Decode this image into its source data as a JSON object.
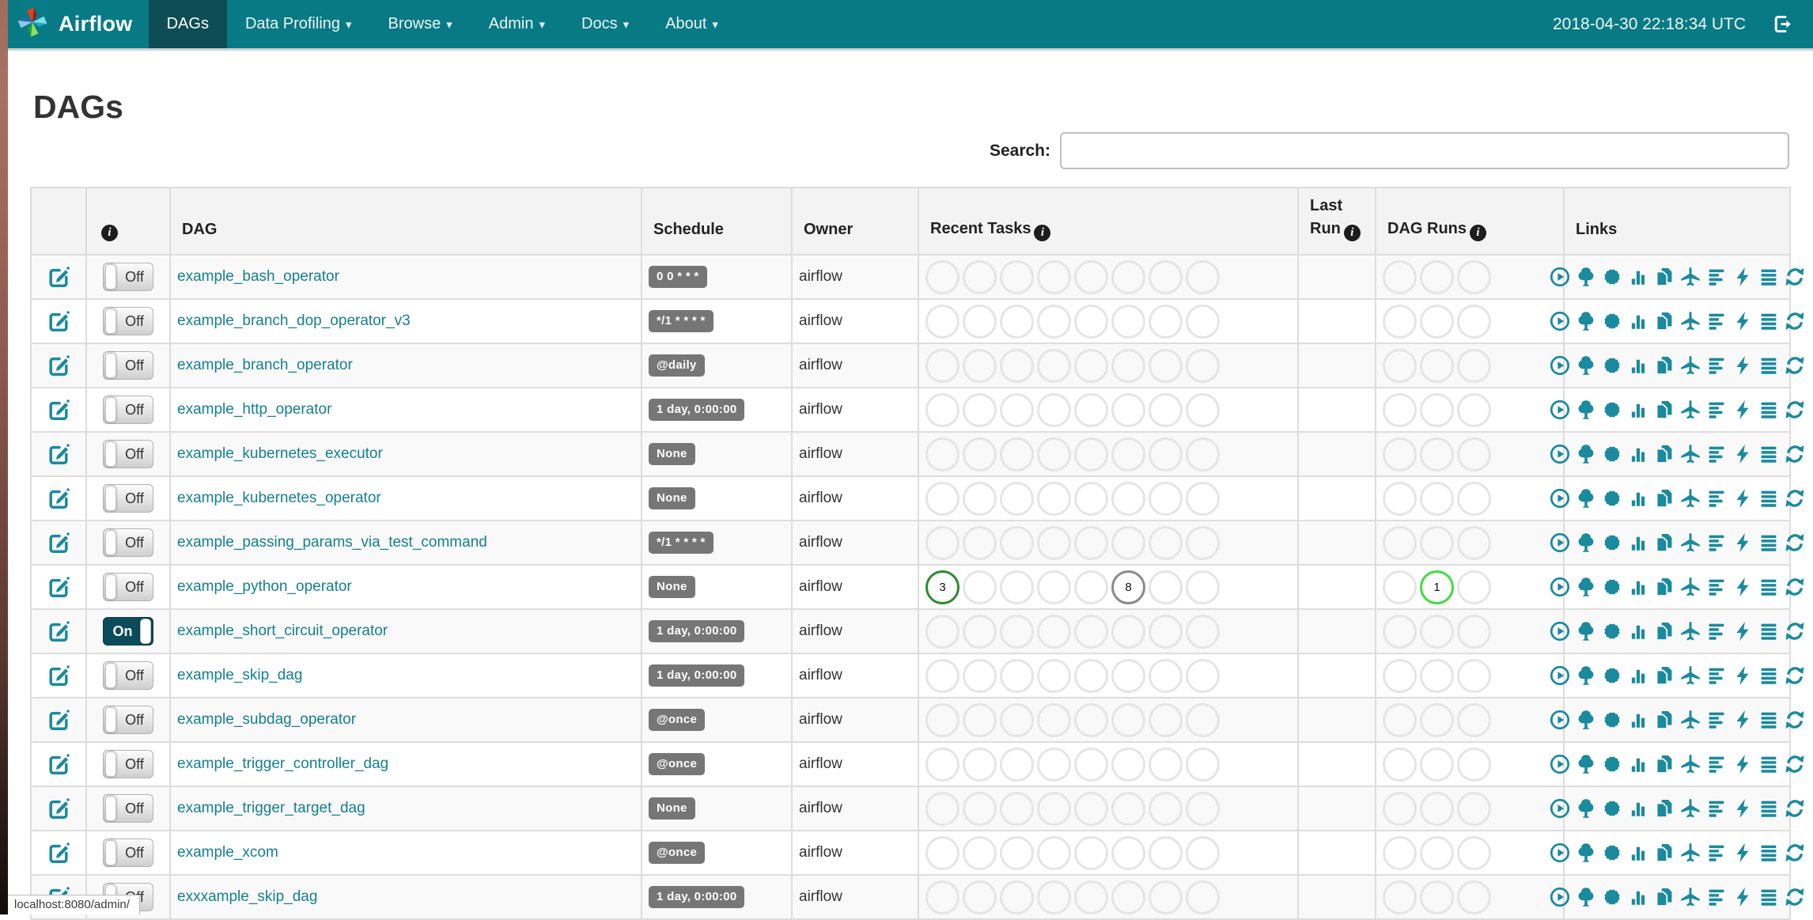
{
  "navbar": {
    "brand": "Airflow",
    "items": [
      {
        "label": "DAGs",
        "active": true,
        "caret": false
      },
      {
        "label": "Data Profiling",
        "active": false,
        "caret": true
      },
      {
        "label": "Browse",
        "active": false,
        "caret": true
      },
      {
        "label": "Admin",
        "active": false,
        "caret": true
      },
      {
        "label": "Docs",
        "active": false,
        "caret": true
      },
      {
        "label": "About",
        "active": false,
        "caret": true
      }
    ],
    "clock": "2018-04-30 22:18:34 UTC",
    "icons": {
      "logo": "airflow-pinwheel-logo",
      "logout": "sign-out-icon"
    }
  },
  "page": {
    "title": "DAGs",
    "search_label": "Search:",
    "search_value": "",
    "status_bar": "localhost:8080/admin/"
  },
  "table": {
    "headers": {
      "info_col": "",
      "dag": "DAG",
      "schedule": "Schedule",
      "owner": "Owner",
      "recent_tasks": "Recent Tasks",
      "last_run_line1": "Last",
      "last_run_line2": "Run",
      "dag_runs": "DAG Runs",
      "links": "Links"
    },
    "toggle_labels": {
      "on": "On",
      "off": "Off"
    },
    "recent_tasks_slots": 8,
    "dag_runs_slots": 3,
    "links_icons": [
      "trigger-dag-icon",
      "tree-view-icon",
      "graph-view-icon",
      "task-duration-icon",
      "task-tries-icon",
      "landing-times-icon",
      "gantt-view-icon",
      "code-view-icon",
      "logs-icon",
      "refresh-icon"
    ],
    "dags": [
      {
        "name": "example_bash_operator",
        "enabled": false,
        "schedule": "0 0 * * *",
        "owner": "airflow",
        "recent_tasks": [],
        "dag_runs": []
      },
      {
        "name": "example_branch_dop_operator_v3",
        "enabled": false,
        "schedule": "*/1 * * * *",
        "owner": "airflow",
        "recent_tasks": [],
        "dag_runs": []
      },
      {
        "name": "example_branch_operator",
        "enabled": false,
        "schedule": "@daily",
        "owner": "airflow",
        "recent_tasks": [],
        "dag_runs": []
      },
      {
        "name": "example_http_operator",
        "enabled": false,
        "schedule": "1 day, 0:00:00",
        "owner": "airflow",
        "recent_tasks": [],
        "dag_runs": []
      },
      {
        "name": "example_kubernetes_executor",
        "enabled": false,
        "schedule": "None",
        "owner": "airflow",
        "recent_tasks": [],
        "dag_runs": []
      },
      {
        "name": "example_kubernetes_operator",
        "enabled": false,
        "schedule": "None",
        "owner": "airflow",
        "recent_tasks": [],
        "dag_runs": []
      },
      {
        "name": "example_passing_params_via_test_command",
        "enabled": false,
        "schedule": "*/1 * * * *",
        "owner": "airflow",
        "recent_tasks": [],
        "dag_runs": []
      },
      {
        "name": "example_python_operator",
        "enabled": false,
        "schedule": "None",
        "owner": "airflow",
        "recent_tasks": [
          {
            "slot": 0,
            "count": "3",
            "state": "success",
            "color": "#2e8b2e"
          },
          {
            "slot": 5,
            "count": "8",
            "state": "queued",
            "color": "#8a8a8a"
          }
        ],
        "dag_runs": [
          {
            "slot": 1,
            "count": "1",
            "state": "running",
            "color": "#3fdd3f"
          }
        ]
      },
      {
        "name": "example_short_circuit_operator",
        "enabled": true,
        "schedule": "1 day, 0:00:00",
        "owner": "airflow",
        "recent_tasks": [],
        "dag_runs": []
      },
      {
        "name": "example_skip_dag",
        "enabled": false,
        "schedule": "1 day, 0:00:00",
        "owner": "airflow",
        "recent_tasks": [],
        "dag_runs": []
      },
      {
        "name": "example_subdag_operator",
        "enabled": false,
        "schedule": "@once",
        "owner": "airflow",
        "recent_tasks": [],
        "dag_runs": []
      },
      {
        "name": "example_trigger_controller_dag",
        "enabled": false,
        "schedule": "@once",
        "owner": "airflow",
        "recent_tasks": [],
        "dag_runs": []
      },
      {
        "name": "example_trigger_target_dag",
        "enabled": false,
        "schedule": "None",
        "owner": "airflow",
        "recent_tasks": [],
        "dag_runs": []
      },
      {
        "name": "example_xcom",
        "enabled": false,
        "schedule": "@once",
        "owner": "airflow",
        "recent_tasks": [],
        "dag_runs": []
      },
      {
        "name": "exxxample_skip_dag",
        "enabled": false,
        "schedule": "1 day, 0:00:00",
        "owner": "airflow",
        "recent_tasks": [],
        "dag_runs": []
      }
    ]
  },
  "colors": {
    "navbar": "#077A85",
    "navbar_active": "#0E4D56",
    "link": "#15808F",
    "icon_teal": "#1A8A9E",
    "schedule_badge": "#767676",
    "circle_empty_border": "#E5E5E5",
    "task_success": "#2E8B2E",
    "task_queued": "#8A8A8A",
    "dag_run_running": "#3FDD3F",
    "toggle_on_bg": "#0A4B5C"
  }
}
